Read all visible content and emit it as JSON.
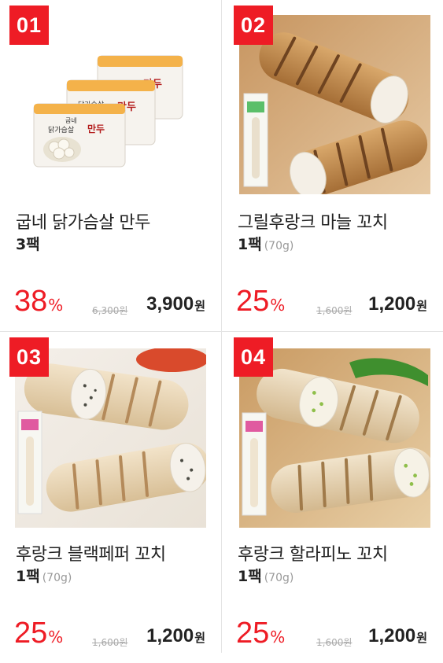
{
  "products": [
    {
      "rank": "01",
      "name": "굽네 닭가슴살 만두",
      "qty": "3팩",
      "weight": "",
      "discount": "38",
      "pct": "%",
      "original_price": "6,300원",
      "sale_price": "3,900",
      "currency": "원",
      "package_text": "닭가슴살",
      "package_accent": "만두",
      "package_brand": "굽네"
    },
    {
      "rank": "02",
      "name": "그릴후랑크 마늘 꼬치",
      "qty": "1팩",
      "weight": "(70g)",
      "discount": "25",
      "pct": "%",
      "original_price": "1,600원",
      "sale_price": "1,200",
      "currency": "원"
    },
    {
      "rank": "03",
      "name": "후랑크 블랙페퍼 꼬치",
      "qty": "1팩",
      "weight": "(70g)",
      "discount": "25",
      "pct": "%",
      "original_price": "1,600원",
      "sale_price": "1,200",
      "currency": "원"
    },
    {
      "rank": "04",
      "name": "후랑크 할라피노 꼬치",
      "qty": "1팩",
      "weight": "(70g)",
      "discount": "25",
      "pct": "%",
      "original_price": "1,600원",
      "sale_price": "1,200",
      "currency": "원"
    }
  ],
  "colors": {
    "accent": "#ee1c25",
    "sausage": "#e8dcc8",
    "grill": "#a77a48"
  }
}
